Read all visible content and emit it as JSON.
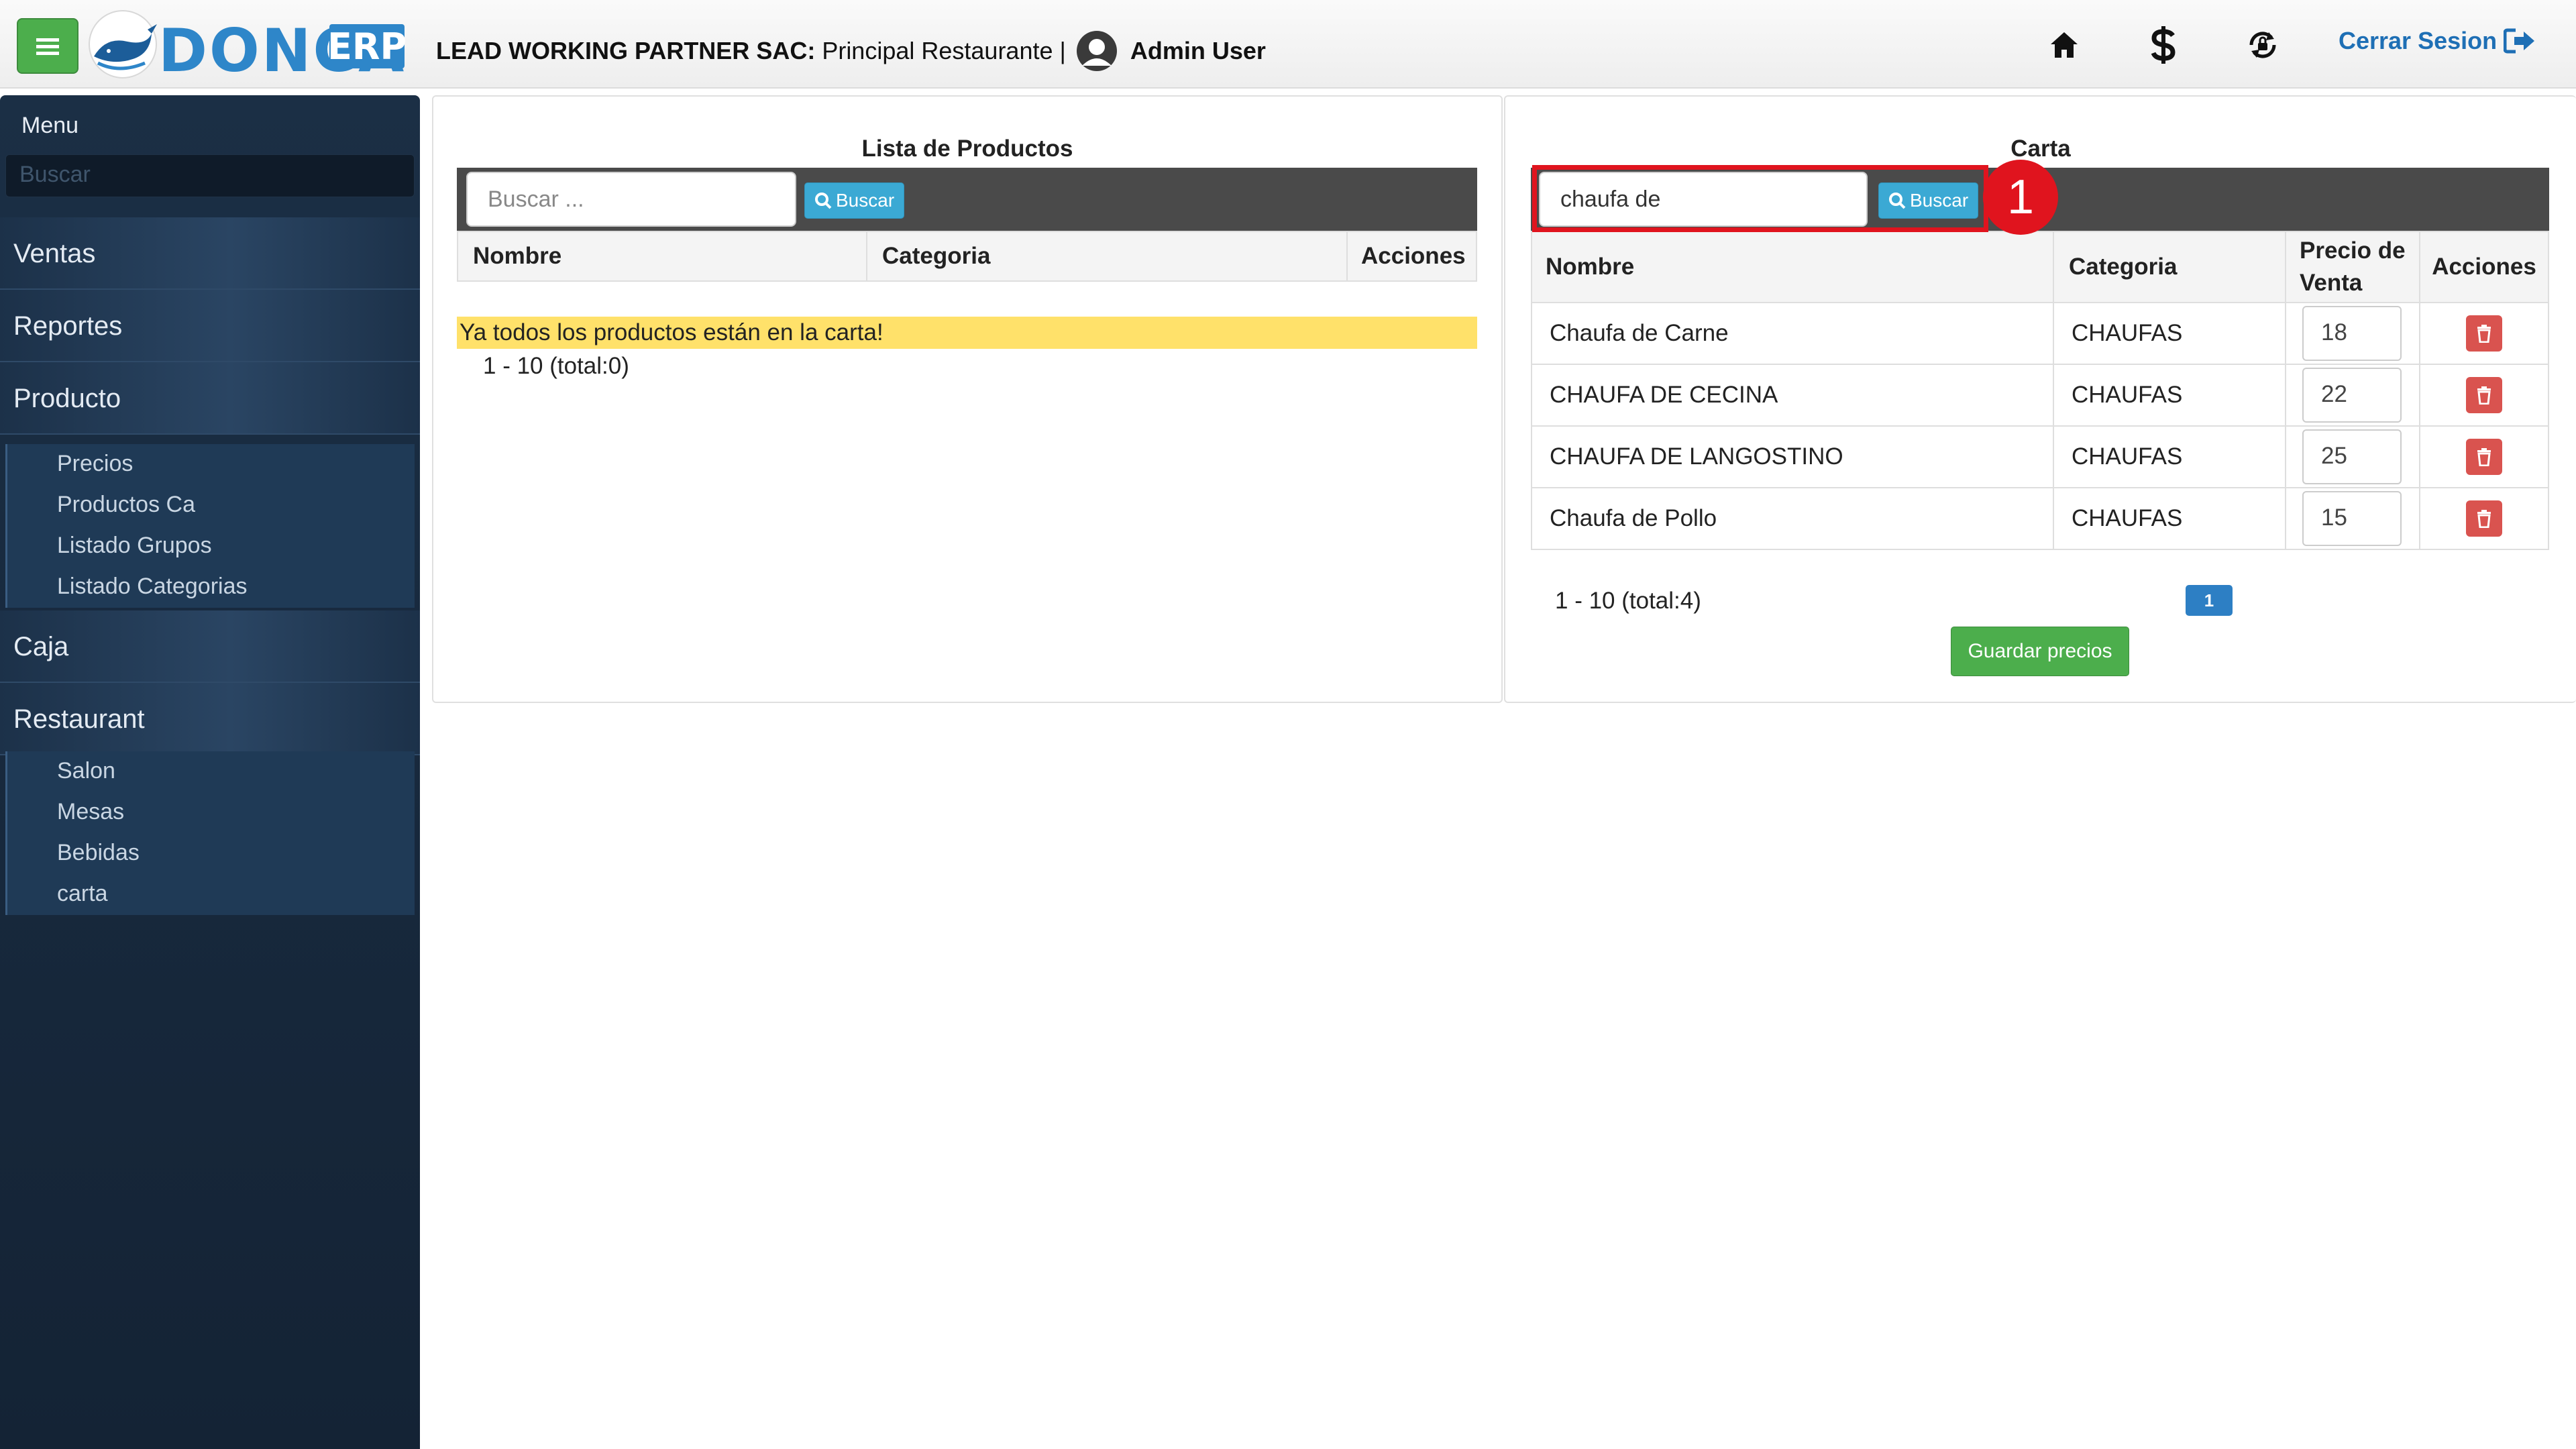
{
  "header": {
    "brand_word": "DONCA",
    "brand_badge": "ERP",
    "company": "LEAD WORKING PARTNER SAC:",
    "branch": "Principal Restaurante |",
    "user": "Admin User",
    "logout_label": "Cerrar Sesion",
    "icons": [
      "home-icon",
      "dollar-icon",
      "lock-refresh-icon",
      "logout-icon"
    ]
  },
  "sidebar": {
    "menu_label": "Menu",
    "search_placeholder": "Buscar",
    "items": [
      {
        "label": "Ventas"
      },
      {
        "label": "Reportes"
      },
      {
        "label": "Producto",
        "children": [
          "Precios",
          "Productos Ca",
          "Listado Grupos",
          "Listado Categorias"
        ]
      },
      {
        "label": "Caja"
      },
      {
        "label": "Restaurant",
        "children": [
          "Salon",
          "Mesas",
          "Bebidas",
          "carta"
        ]
      }
    ]
  },
  "left_panel": {
    "title": "Lista de Productos",
    "search_placeholder": "Buscar ...",
    "search_button": "Buscar",
    "columns": [
      "Nombre",
      "Categoria",
      "Acciones"
    ],
    "empty_message": "Ya todos los productos están en la carta!",
    "pager": "1 - 10 (total:0)"
  },
  "right_panel": {
    "title": "Carta",
    "search_value": "chaufa de",
    "search_button": "Buscar",
    "columns": [
      "Nombre",
      "Categoria",
      "Precio de Venta",
      "Acciones"
    ],
    "rows": [
      {
        "name": "Chaufa de Carne",
        "category": "CHAUFAS",
        "price": "18"
      },
      {
        "name": "CHAUFA DE CECINA",
        "category": "CHAUFAS",
        "price": "22"
      },
      {
        "name": "CHAUFA DE LANGOSTINO",
        "category": "CHAUFAS",
        "price": "25"
      },
      {
        "name": "Chaufa de Pollo",
        "category": "CHAUFAS",
        "price": "15"
      }
    ],
    "pager": "1 - 10 (total:4)",
    "page": "1",
    "save_button": "Guardar precios"
  },
  "annotation": {
    "marker": "1",
    "color": "#e0141e"
  },
  "colors": {
    "accent_green": "#4cae4c",
    "accent_blue": "#3ba9d4",
    "danger": "#d9534f",
    "sidebar": "#1b2f45"
  }
}
